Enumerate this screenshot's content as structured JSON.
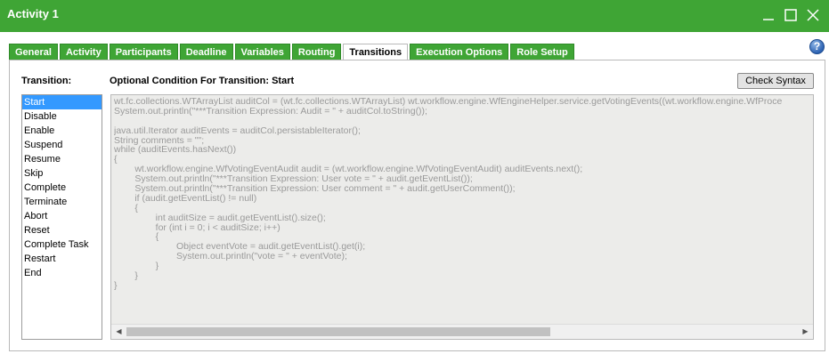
{
  "window": {
    "title": "Activity 1",
    "controls": [
      "minimize-icon",
      "maximize-icon",
      "close-icon"
    ],
    "title_bar_color": "#3fa535"
  },
  "help_label": "?",
  "tabs": [
    {
      "label": "General"
    },
    {
      "label": "Activity"
    },
    {
      "label": "Participants"
    },
    {
      "label": "Deadline"
    },
    {
      "label": "Variables"
    },
    {
      "label": "Routing"
    },
    {
      "label": "Transitions",
      "active": true
    },
    {
      "label": "Execution Options"
    },
    {
      "label": "Role Setup"
    }
  ],
  "transitions_panel": {
    "transition_label": "Transition:",
    "condition_label": "Optional Condition For Transition: Start",
    "check_syntax_label": "Check Syntax",
    "selected_transition": "Start",
    "transitions": [
      "Start",
      "Disable",
      "Enable",
      "Suspend",
      "Resume",
      "Skip",
      "Complete",
      "Terminate",
      "Abort",
      "Reset",
      "Complete Task",
      "Restart",
      "End"
    ],
    "code_lines": [
      "wt.fc.collections.WTArrayList auditCol = (wt.fc.collections.WTArrayList) wt.workflow.engine.WfEngineHelper.service.getVotingEvents((wt.workflow.engine.WfProce",
      "System.out.println(\"***Transition Expression: Audit = \" + auditCol.toString());",
      "",
      "java.util.Iterator auditEvents = auditCol.persistableIterator();",
      "String comments = \"\";",
      "while (auditEvents.hasNext())",
      "{",
      "        wt.workflow.engine.WfVotingEventAudit audit = (wt.workflow.engine.WfVotingEventAudit) auditEvents.next();",
      "        System.out.println(\"***Transition Expression: User vote = \" + audit.getEventList());",
      "        System.out.println(\"***Transition Expression: User comment = \" + audit.getUserComment());",
      "        if (audit.getEventList() != null)",
      "        {",
      "                int auditSize = audit.getEventList().size();",
      "                for (int i = 0; i < auditSize; i++)",
      "                {",
      "                        Object eventVote = audit.getEventList().get(i);",
      "                        System.out.println(\"vote = \" + eventVote);",
      "                }",
      "        }",
      "}"
    ]
  }
}
